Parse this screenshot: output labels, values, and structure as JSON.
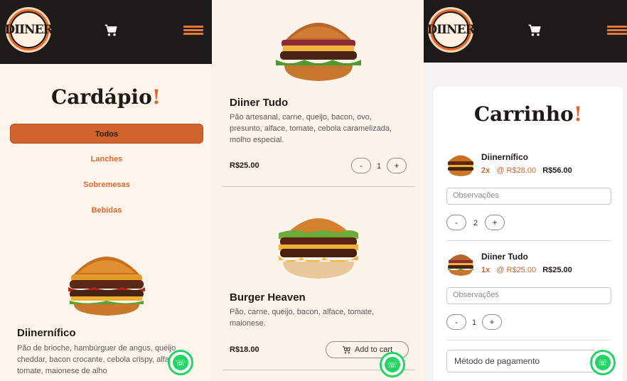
{
  "brand": {
    "logo_text": "DIINER"
  },
  "menu_screen": {
    "title": "Cardápio",
    "title_mark": "!",
    "categories": [
      {
        "label": "Todos",
        "active": true
      },
      {
        "label": "Lanches",
        "active": false
      },
      {
        "label": "Sobremesas",
        "active": false
      },
      {
        "label": "Bebidas",
        "active": false
      }
    ],
    "product": {
      "name": "Diinernífico",
      "description": "Pão de brioche, hambúrguer de angus, queijo cheddar, bacon crocante, cebola crispy, alface, tomate, maionese de alho"
    }
  },
  "list_screen": {
    "products": [
      {
        "name": "Diiner Tudo",
        "description": "Pão artesanal, carne, queijo, bacon, ovo, presunto, alface, tomate, cebola caramelizada, molho especial.",
        "price": "R$25.00",
        "minus": "-",
        "qty": "1",
        "plus": "+"
      },
      {
        "name": "Burger Heaven",
        "description": "Pão, carne, queijo, bacon, alface, tomate, maionese.",
        "price": "R$18.00",
        "add_label": "Add to cart"
      }
    ]
  },
  "cart_screen": {
    "title": "Carrinho",
    "title_mark": "!",
    "items": [
      {
        "name": "Diinernífico",
        "qty_label": "2x",
        "unit_label": "@ R$28.00",
        "total_label": "R$56.00",
        "notes_placeholder": "Observações",
        "minus": "-",
        "qty": "2",
        "plus": "+"
      },
      {
        "name": "Diiner Tudo",
        "qty_label": "1x",
        "unit_label": "@ R$25.00",
        "total_label": "R$25.00",
        "notes_placeholder": "Observações",
        "minus": "-",
        "qty": "1",
        "plus": "+"
      }
    ],
    "payment_placeholder": "Método de pagamento"
  },
  "icons": {
    "cart": "cart-icon",
    "menu": "hamburger-menu-icon",
    "whatsapp": "whatsapp-icon"
  },
  "colors": {
    "brand_orange": "#e2672b",
    "dark": "#1e1a17",
    "whatsapp": "#25d366"
  }
}
